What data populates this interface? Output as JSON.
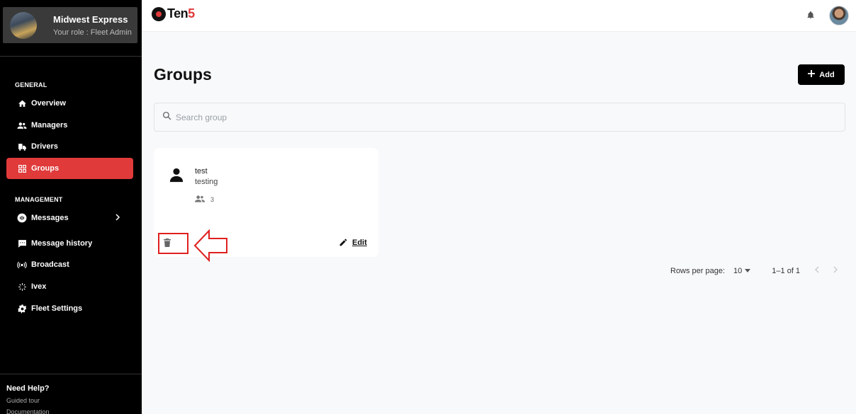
{
  "sidebar": {
    "company_name": "Midwest Express",
    "role": "Your role : Fleet Admin",
    "general_label": "GENERAL",
    "management_label": "MANAGEMENT",
    "general_items": [
      {
        "label": "Overview",
        "icon": "home-icon"
      },
      {
        "label": "Managers",
        "icon": "people-icon"
      },
      {
        "label": "Drivers",
        "icon": "truck-icon"
      },
      {
        "label": "Groups",
        "icon": "grid-icon",
        "active": true
      }
    ],
    "management_items": [
      {
        "label": "Messages",
        "icon": "message-bubble-icon"
      },
      {
        "label": "Message history",
        "icon": "chat-icon"
      },
      {
        "label": "Broadcast",
        "icon": "broadcast-icon"
      },
      {
        "label": "Ivex",
        "icon": "spinner-icon"
      },
      {
        "label": "Fleet Settings",
        "icon": "gear-icon"
      }
    ],
    "help_title": "Need Help?",
    "help_links": [
      "Guided tour",
      "Documentation"
    ]
  },
  "topbar": {
    "brand_main": "Ten",
    "brand_accent": "5"
  },
  "main": {
    "title": "Groups",
    "add_label": "Add",
    "search_placeholder": "Search group"
  },
  "groups": [
    {
      "name": "test",
      "description": "testing",
      "member_count": "3",
      "edit_label": "Edit"
    }
  ],
  "pagination": {
    "rows_label": "Rows per page:",
    "rows_value": "10",
    "range": "1–1 of 1"
  },
  "colors": {
    "accent": "#e03a3a",
    "sidebar_bg": "#000000"
  }
}
